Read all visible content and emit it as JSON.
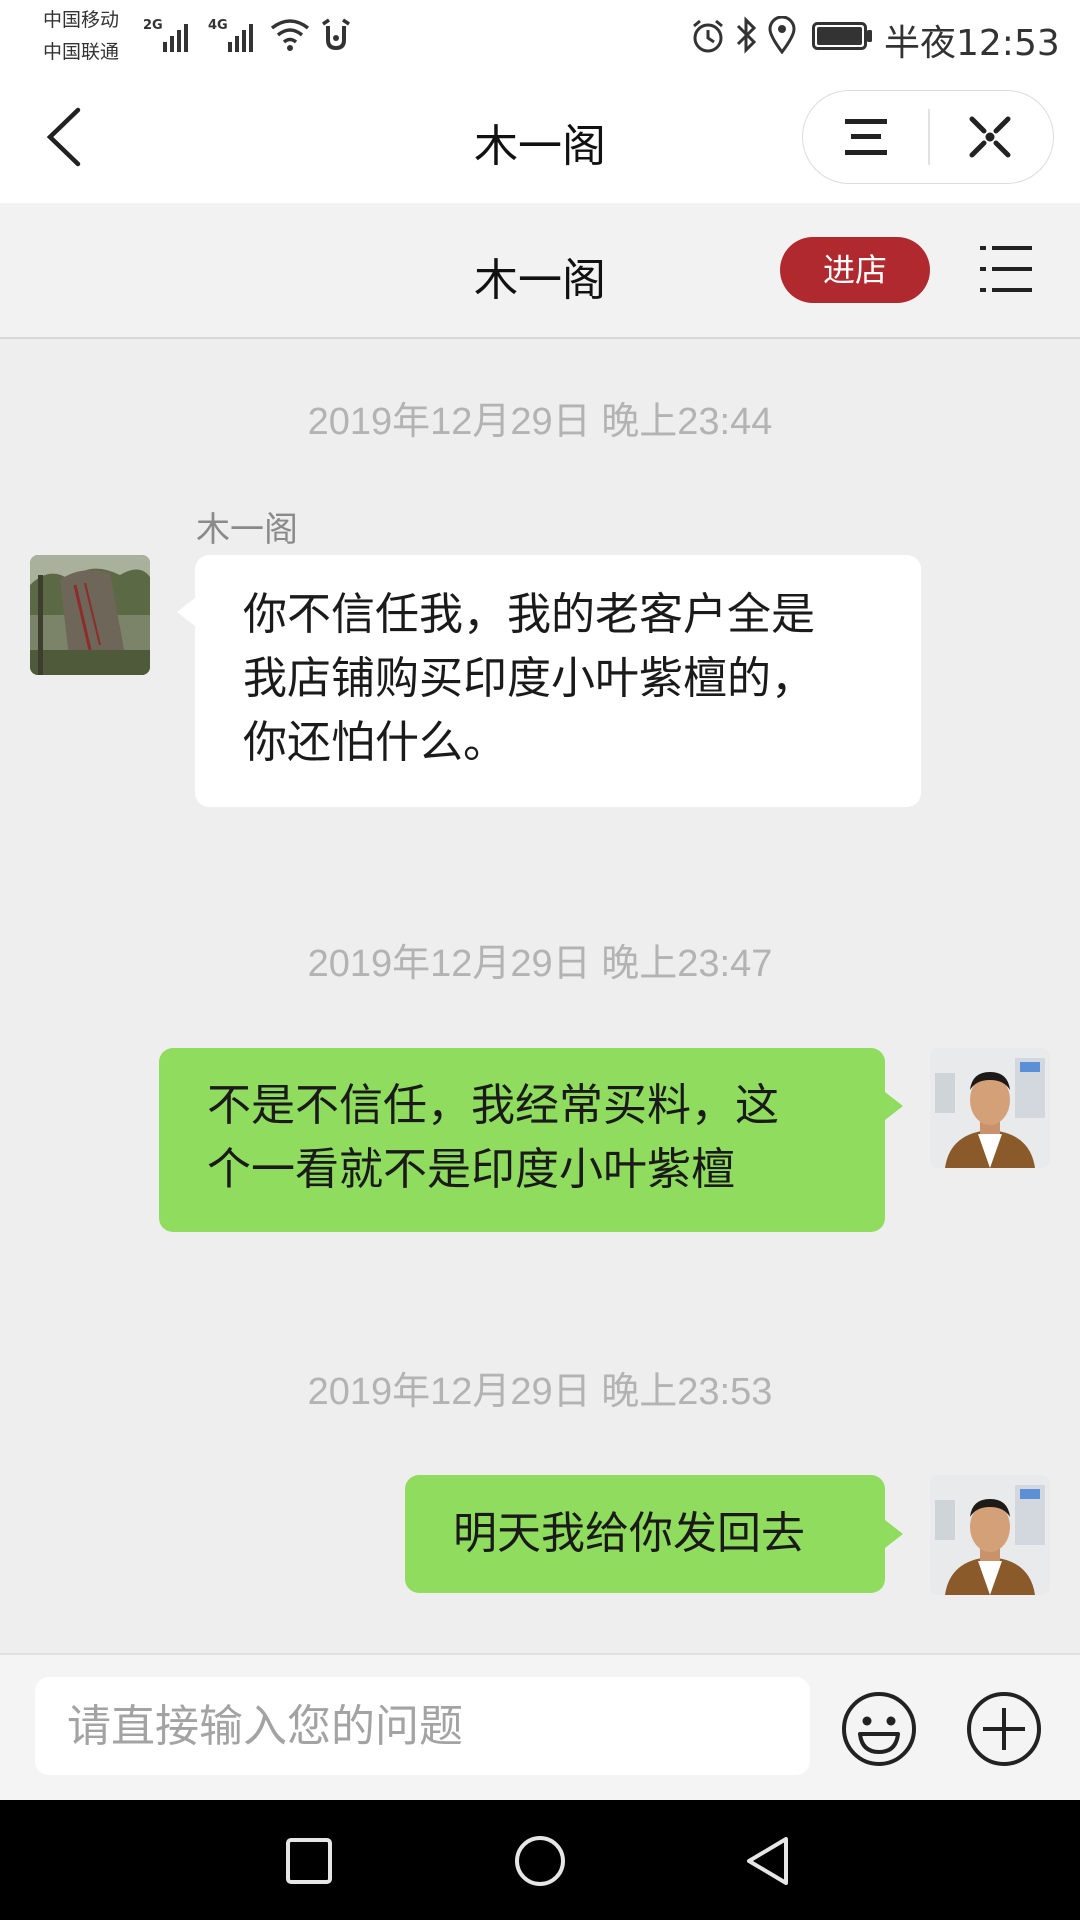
{
  "status_bar": {
    "carrier_1": "中国移动",
    "carrier_2": "中国联通",
    "net_1": "2G",
    "net_2": "4G",
    "time": "半夜12:53",
    "icons": [
      "signal-icon",
      "wifi-icon",
      "alarm-icon",
      "bluetooth-icon",
      "location-icon",
      "battery-icon"
    ]
  },
  "title_bar": {
    "title": "木一阁",
    "icons": [
      "back-icon",
      "menu-icon",
      "close-icon"
    ]
  },
  "shop_header": {
    "name": "木一阁",
    "enter_label": "进店",
    "accent_color": "#b0292e"
  },
  "messages": [
    {
      "timestamp": "2019年12月29日 晚上23:44",
      "direction": "incoming",
      "sender": "木一阁",
      "text_lines": [
        "你不信任我，我的老客户全是",
        "我店铺购买印度小叶紫檀的，",
        "你还怕什么。"
      ]
    },
    {
      "timestamp": "2019年12月29日 晚上23:47",
      "direction": "outgoing",
      "text_lines": [
        "不是不信任，我经常买料，这",
        "个一看就不是印度小叶紫檀"
      ]
    },
    {
      "timestamp": "2019年12月29日 晚上23:53",
      "direction": "outgoing",
      "text_lines": [
        "明天我给你发回去"
      ]
    }
  ],
  "input_bar": {
    "placeholder": "请直接输入您的问题",
    "icons": [
      "emoji-icon",
      "plus-icon"
    ]
  },
  "nav_bar": {
    "icons": [
      "recents-icon",
      "home-icon",
      "back-triangle-icon"
    ]
  },
  "colors": {
    "outgoing_bubble": "#8fdc5e",
    "incoming_bubble": "#ffffff",
    "background": "#eeeeee"
  }
}
